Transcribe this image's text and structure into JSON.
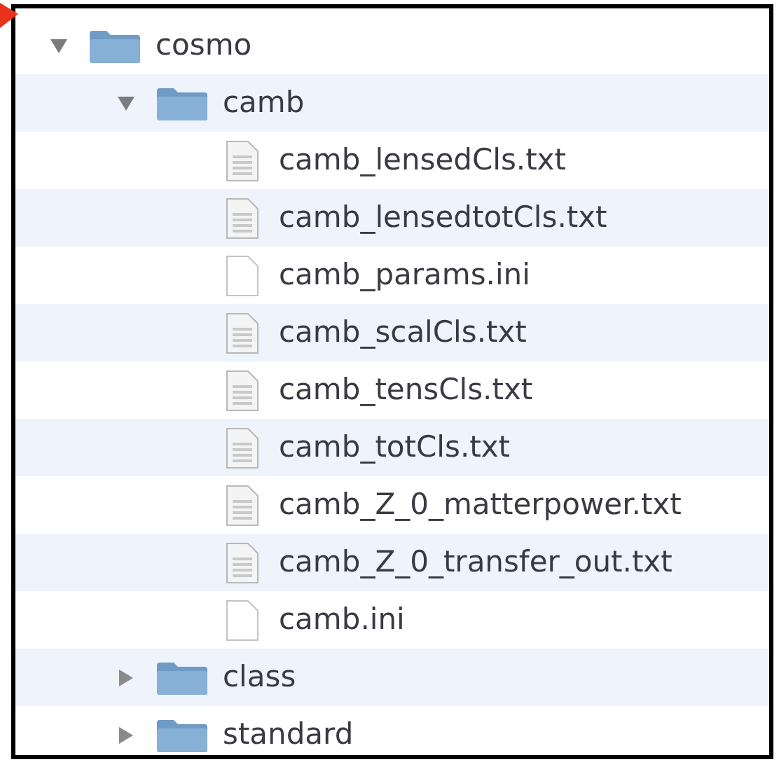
{
  "tree": [
    {
      "name": "cosmo",
      "kind": "folder",
      "expanded": true,
      "children": [
        {
          "name": "camb",
          "kind": "folder",
          "expanded": true,
          "children": [
            {
              "name": "camb_lensedCls.txt",
              "kind": "text"
            },
            {
              "name": "camb_lensedtotCls.txt",
              "kind": "text"
            },
            {
              "name": "camb_params.ini",
              "kind": "blank"
            },
            {
              "name": "camb_scalCls.txt",
              "kind": "text"
            },
            {
              "name": "camb_tensCls.txt",
              "kind": "text"
            },
            {
              "name": "camb_totCls.txt",
              "kind": "text"
            },
            {
              "name": "camb_Z_0_matterpower.txt",
              "kind": "text"
            },
            {
              "name": "camb_Z_0_transfer_out.txt",
              "kind": "text"
            },
            {
              "name": "camb.ini",
              "kind": "blank"
            }
          ]
        },
        {
          "name": "class",
          "kind": "folder",
          "expanded": false
        },
        {
          "name": "standard",
          "kind": "folder",
          "expanded": false
        }
      ]
    }
  ]
}
